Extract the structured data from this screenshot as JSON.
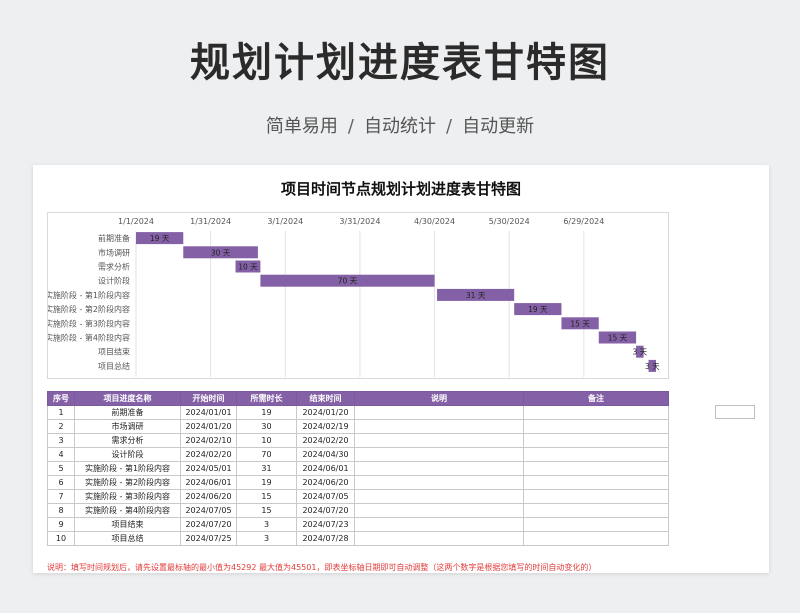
{
  "hero": {
    "title": "规划计划进度表甘特图",
    "tags": [
      "简单易用",
      "自动统计",
      "自动更新"
    ],
    "separator": "/"
  },
  "sheet": {
    "title": "项目时间节点规划计划进度表甘特图",
    "note": "说明：填写时间规划后，请先设置最标轴的最小值为45292 最大值为45501，即表坐标轴日期即可自动调整（这两个数字是根据您填写的时间自动变化的）"
  },
  "chart_data": {
    "type": "bar",
    "orientation": "horizontal-gantt",
    "x_ticks": [
      "1/1/2024",
      "1/31/2024",
      "3/1/2024",
      "3/31/2024",
      "4/30/2024",
      "5/30/2024",
      "6/29/2024"
    ],
    "xlim": [
      "2024-01-01",
      "2024-07-28"
    ],
    "categories": [
      "前期准备",
      "市场调研",
      "需求分析",
      "设计阶段",
      "实施阶段 - 第1阶段内容",
      "实施阶段 - 第2阶段内容",
      "实施阶段 - 第3阶段内容",
      "实施阶段 - 第4阶段内容",
      "项目结束",
      "项目总结"
    ],
    "start": [
      "2024-01-01",
      "2024-01-20",
      "2024-02-10",
      "2024-02-20",
      "2024-05-01",
      "2024-06-01",
      "2024-06-20",
      "2024-07-05",
      "2024-07-20",
      "2024-07-25"
    ],
    "duration_days": [
      19,
      30,
      10,
      70,
      31,
      19,
      15,
      15,
      3,
      3
    ],
    "bar_labels": [
      "19 天",
      "30 天",
      "10 天",
      "70 天",
      "31 天",
      "19 天",
      "15 天",
      "15 天",
      "3 天",
      "3 天"
    ],
    "bar_color": "#8461a6",
    "grid": true
  },
  "table": {
    "headers": [
      "序号",
      "项目进度名称",
      "开始时间",
      "所需时长",
      "结束时间",
      "说明",
      "备注"
    ],
    "rows": [
      [
        "1",
        "前期准备",
        "2024/01/01",
        "19",
        "2024/01/20",
        "",
        ""
      ],
      [
        "2",
        "市场调研",
        "2024/01/20",
        "30",
        "2024/02/19",
        "",
        ""
      ],
      [
        "3",
        "需求分析",
        "2024/02/10",
        "10",
        "2024/02/20",
        "",
        ""
      ],
      [
        "4",
        "设计阶段",
        "2024/02/20",
        "70",
        "2024/04/30",
        "",
        ""
      ],
      [
        "5",
        "实施阶段 - 第1阶段内容",
        "2024/05/01",
        "31",
        "2024/06/01",
        "",
        ""
      ],
      [
        "6",
        "实施阶段 - 第2阶段内容",
        "2024/06/01",
        "19",
        "2024/06/20",
        "",
        ""
      ],
      [
        "7",
        "实施阶段 - 第3阶段内容",
        "2024/06/20",
        "15",
        "2024/07/05",
        "",
        ""
      ],
      [
        "8",
        "实施阶段 - 第4阶段内容",
        "2024/07/05",
        "15",
        "2024/07/20",
        "",
        ""
      ],
      [
        "9",
        "项目结束",
        "2024/07/20",
        "3",
        "2024/07/23",
        "",
        ""
      ],
      [
        "10",
        "项目总结",
        "2024/07/25",
        "3",
        "2024/07/28",
        "",
        ""
      ]
    ]
  },
  "colors": {
    "accent": "#8461a6",
    "note": "#e23b3b"
  }
}
